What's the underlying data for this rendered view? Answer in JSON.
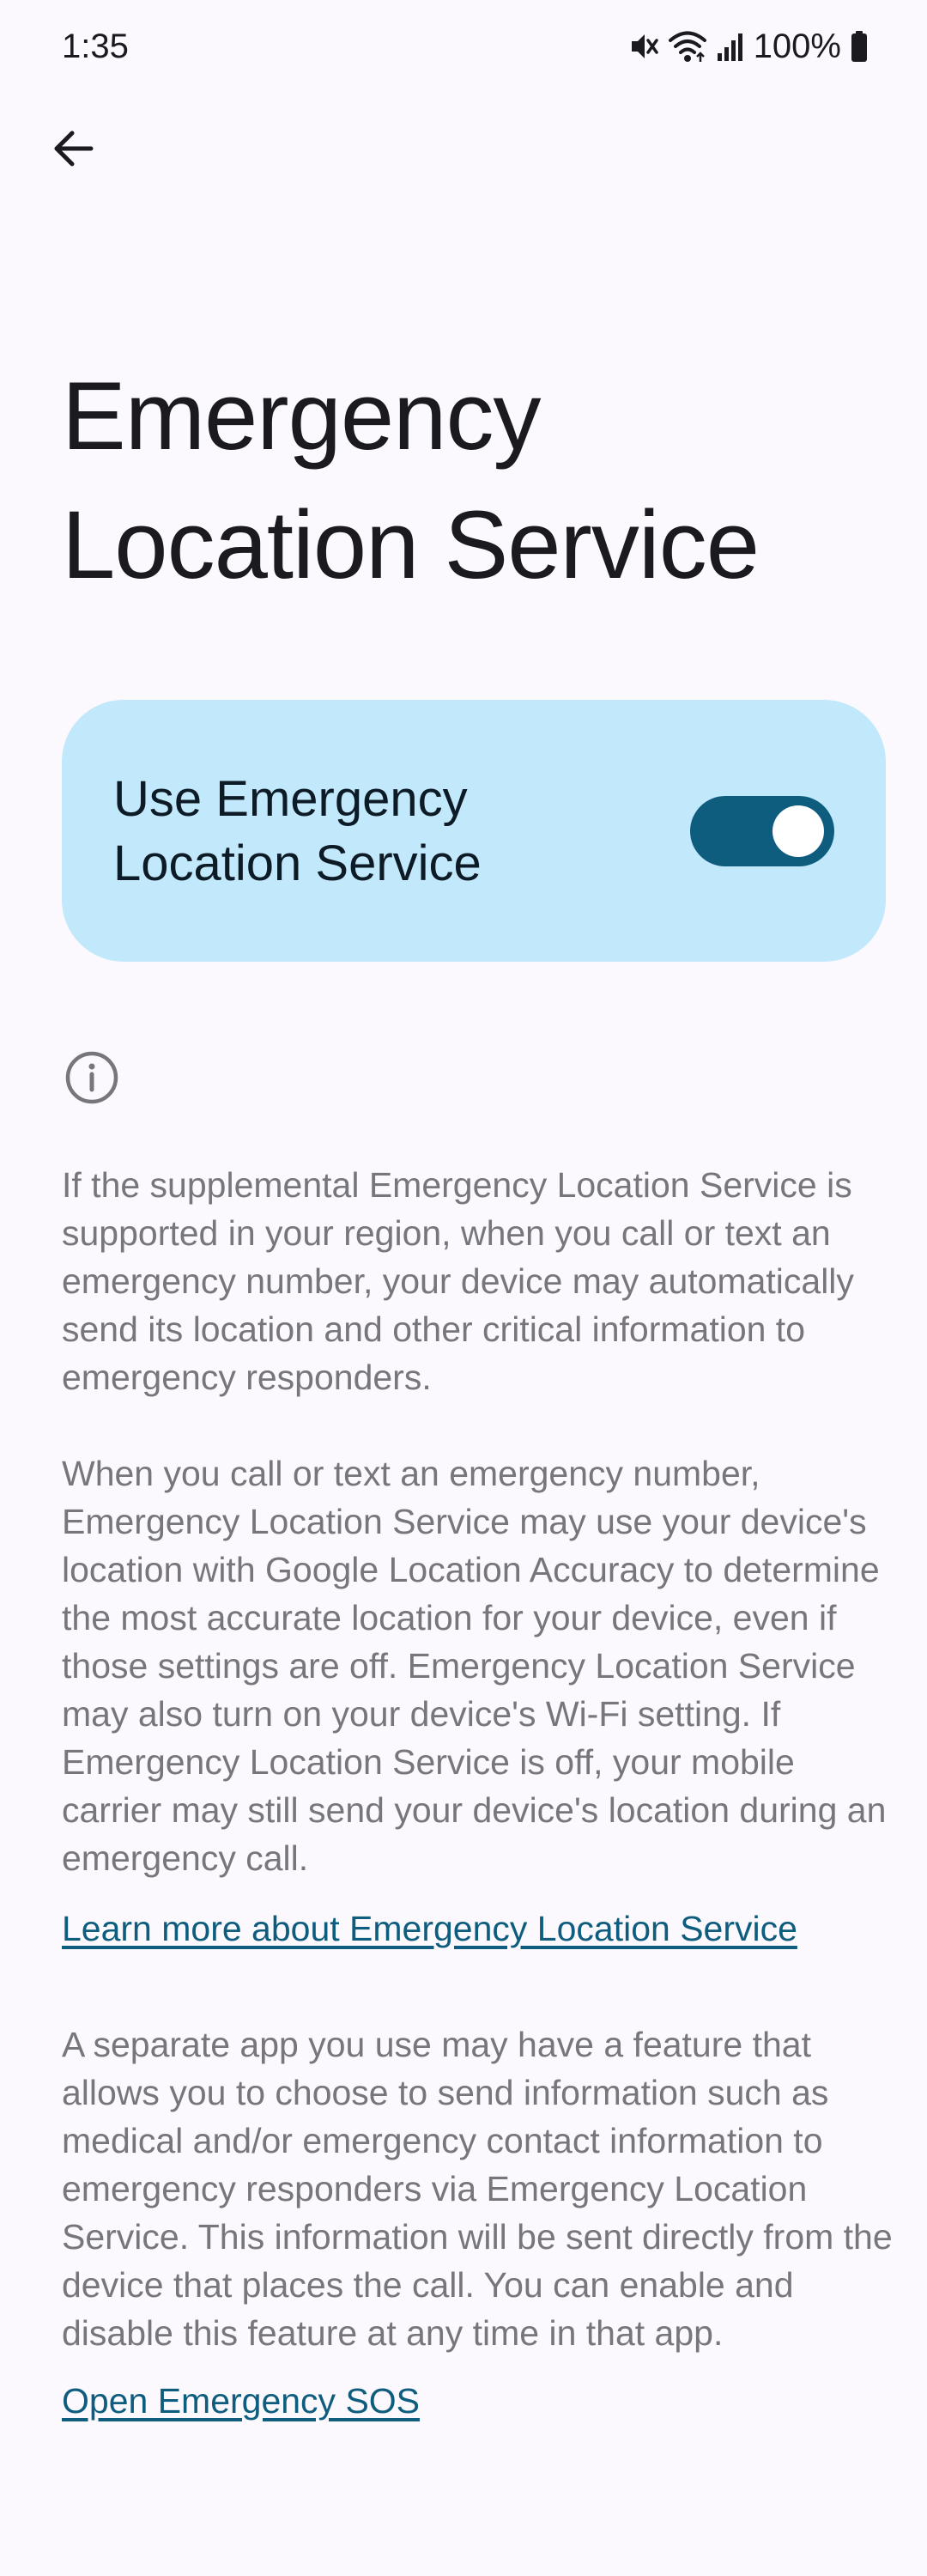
{
  "status_bar": {
    "time": "1:35",
    "battery_percent": "100%",
    "icons": [
      "mute-icon",
      "wifi-icon",
      "signal-icon",
      "battery-icon"
    ]
  },
  "header": {
    "back_icon": "arrow-back-icon",
    "title": "Emergency Location Service"
  },
  "toggle": {
    "label": "Use Emergency Location Service",
    "checked": true,
    "colors": {
      "card_bg": "#c2e8fc",
      "track": "#0f5d7e",
      "thumb": "#ffffff"
    }
  },
  "info": {
    "icon": "info-icon",
    "paragraph_1": "If the supplemental Emergency Location Service is supported in your region, when you call or text an emergency number, your device may automatically send its location and other critical information to emergency responders.",
    "paragraph_2": "When you call or text an emergency number, Emergency Location Service may use your device's location with Google Location Accuracy to determine the most accurate location for your device, even if those settings are off. Emergency Location Service may also turn on your device's Wi-Fi setting. If Emergency Location Service is off, your mobile carrier may still send your device's location during an emergency call.",
    "learn_more_link": "Learn more about Emergency Location Service",
    "paragraph_3": "A separate app you use may have a feature that allows you to choose to send information such as medical and/or emergency contact information to emergency responders via Emergency Location Service. This information will be sent directly from the device that places the call. You can enable and disable this feature at any time in that app.",
    "sos_link": "Open Emergency SOS"
  },
  "colors": {
    "background": "#fbf9fd",
    "text_primary": "#1b1b1f",
    "text_secondary": "#76767c",
    "link": "#0f5d7e"
  }
}
